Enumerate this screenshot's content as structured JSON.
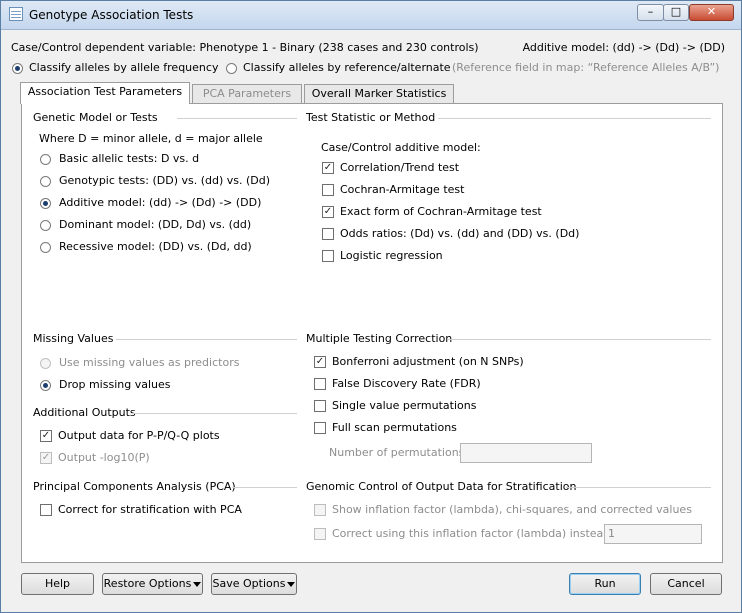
{
  "window": {
    "title": "Genotype Association Tests"
  },
  "header": {
    "dependent_variable": "Case/Control dependent variable: Phenotype 1 - Binary (238 cases and 230 controls)",
    "model_summary": "Additive model: (dd) -> (Dd) -> (DD)",
    "classify_frequency": "Classify alleles by allele frequency",
    "classify_reference": "Classify alleles by reference/alternate",
    "reference_note": "(Reference field in map: “Reference Alleles A/B”)"
  },
  "tabs": [
    {
      "label": "Association Test Parameters",
      "active": true,
      "enabled": true
    },
    {
      "label": "PCA Parameters",
      "active": false,
      "enabled": false
    },
    {
      "label": "Overall Marker Statistics",
      "active": false,
      "enabled": true
    }
  ],
  "genetic_model": {
    "heading": "Genetic Model or Tests",
    "note": "Where D = minor allele, d = major allele",
    "options": [
      {
        "label": "Basic allelic tests: D vs. d",
        "selected": false
      },
      {
        "label": "Genotypic tests: (DD) vs. (dd) vs. (Dd)",
        "selected": false
      },
      {
        "label": "Additive model: (dd) -> (Dd) -> (DD)",
        "selected": true
      },
      {
        "label": "Dominant model: (DD, Dd) vs. (dd)",
        "selected": false
      },
      {
        "label": "Recessive model: (DD) vs. (Dd,  dd)",
        "selected": false
      }
    ]
  },
  "test_statistic": {
    "heading": "Test Statistic or Method",
    "subheading": "Case/Control additive model:",
    "options": [
      {
        "label": "Correlation/Trend test",
        "checked": true
      },
      {
        "label": "Cochran-Armitage test",
        "checked": false
      },
      {
        "label": "Exact form of Cochran-Armitage test",
        "checked": true
      },
      {
        "label": "Odds ratios: (Dd) vs. (dd) and (DD) vs. (Dd)",
        "checked": false
      },
      {
        "label": "Logistic regression",
        "checked": false
      }
    ]
  },
  "missing_values": {
    "heading": "Missing Values",
    "options": [
      {
        "label": "Use missing values as predictors",
        "selected": false,
        "enabled": false
      },
      {
        "label": "Drop missing values",
        "selected": true,
        "enabled": true
      }
    ]
  },
  "additional_outputs": {
    "heading": "Additional Outputs",
    "options": [
      {
        "label": "Output data for P-P/Q-Q plots",
        "checked": true,
        "enabled": true
      },
      {
        "label": "Output -log10(P)",
        "checked": true,
        "enabled": false
      }
    ]
  },
  "multiple_testing": {
    "heading": "Multiple Testing Correction",
    "options": [
      {
        "label": "Bonferroni adjustment (on N SNPs)",
        "checked": true
      },
      {
        "label": "False Discovery Rate (FDR)",
        "checked": false
      },
      {
        "label": "Single value permutations",
        "checked": false
      },
      {
        "label": "Full scan permutations",
        "checked": false
      }
    ],
    "permutations_label": "Number of permutations:",
    "permutations_value": ""
  },
  "pca": {
    "heading": "Principal Components Analysis (PCA)",
    "option": {
      "label": "Correct for stratification with PCA",
      "checked": false
    }
  },
  "genomic_control": {
    "heading": "Genomic Control of Output Data for Stratification",
    "show_inflation": "Show inflation factor (lambda), chi-squares, and corrected values",
    "correct_using": "Correct using this inflation factor (lambda) instead:",
    "lambda_value": "1"
  },
  "buttons": {
    "help": "Help",
    "restore": "Restore Options",
    "save": "Save Options",
    "run": "Run",
    "cancel": "Cancel"
  }
}
